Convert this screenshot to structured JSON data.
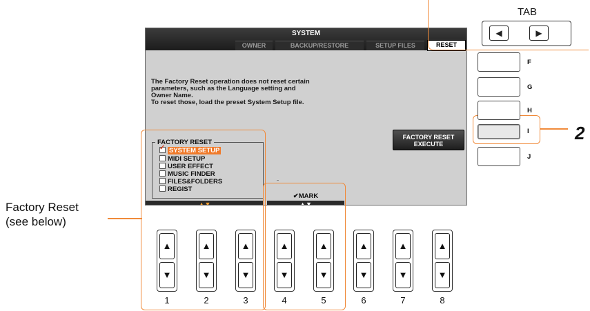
{
  "screen": {
    "title": "SYSTEM",
    "tabs": [
      {
        "label": "OWNER"
      },
      {
        "label": "BACKUP/RESTORE"
      },
      {
        "label": "SETUP FILES"
      },
      {
        "label": "RESET"
      }
    ],
    "info_lines": [
      "The Factory Reset operation does not reset certain",
      "parameters, such as the Language setting and",
      "Owner Name.",
      "To reset those, load the preset System Setup file."
    ],
    "factory_reset": {
      "legend": "FACTORY RESET",
      "items": [
        {
          "label": "SYSTEM SETUP",
          "checked": true,
          "selected": true
        },
        {
          "label": "MIDI SETUP",
          "checked": false
        },
        {
          "label": "USER EFFECT",
          "checked": false
        },
        {
          "label": "MUSIC FINDER",
          "checked": false
        },
        {
          "label": "FILES&FOLDERS",
          "checked": false
        },
        {
          "label": "REGIST",
          "checked": false
        }
      ],
      "selector_arrows": "▲▼"
    },
    "mark": {
      "label": "✔MARK",
      "arrows": "▲▼"
    },
    "execute_button": {
      "line1": "FACTORY RESET",
      "line2": "EXECUTE"
    }
  },
  "tab_control": {
    "label": "TAB",
    "left": "◀",
    "right": "▶"
  },
  "side_buttons": [
    "F",
    "G",
    "H",
    "I",
    "J"
  ],
  "bottom_buttons": [
    "1",
    "2",
    "3",
    "4",
    "5",
    "6",
    "7",
    "8"
  ],
  "arrows": {
    "up": "▲",
    "down": "▼"
  },
  "callout": {
    "line1": "Factory Reset",
    "line2": "(see below)"
  },
  "step_number": "2",
  "colors": {
    "accent": "#f08a3a",
    "selection": "#f07a2a",
    "check": "#d04020"
  }
}
